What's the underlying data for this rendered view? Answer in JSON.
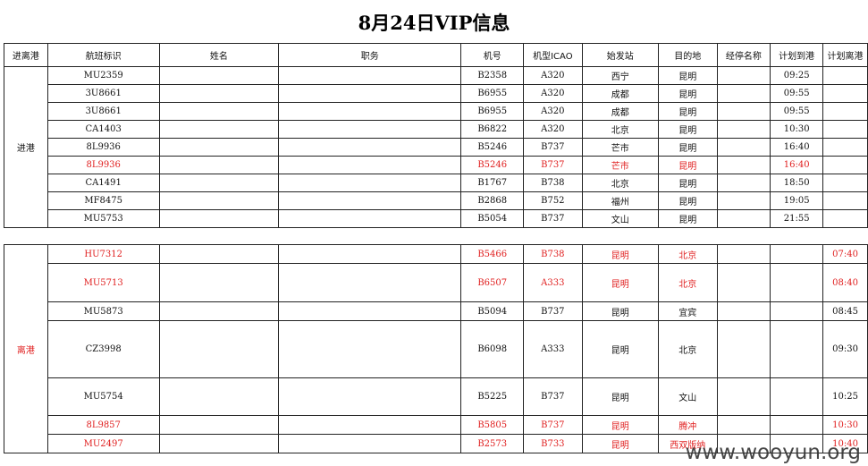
{
  "title": "8月24日VIP信息",
  "headers": [
    "进离港",
    "航班标识",
    "姓名",
    "职务",
    "机号",
    "机型ICAO",
    "始发站",
    "目的地",
    "经停名称",
    "计划到港",
    "计划离港"
  ],
  "arrival_label": "进港",
  "departure_label": "离港",
  "arrivals": [
    {
      "flight": "MU2359",
      "reg": "B2358",
      "type": "A320",
      "from": "西宁",
      "to": "昆明",
      "sta": "09:25",
      "red": false
    },
    {
      "flight": "3U8661",
      "reg": "B6955",
      "type": "A320",
      "from": "成都",
      "to": "昆明",
      "sta": "09:55",
      "red": false
    },
    {
      "flight": "3U8661",
      "reg": "B6955",
      "type": "A320",
      "from": "成都",
      "to": "昆明",
      "sta": "09:55",
      "red": false
    },
    {
      "flight": "CA1403",
      "reg": "B6822",
      "type": "A320",
      "from": "北京",
      "to": "昆明",
      "sta": "10:30",
      "red": false
    },
    {
      "flight": "8L9936",
      "reg": "B5246",
      "type": "B737",
      "from": "芒市",
      "to": "昆明",
      "sta": "16:40",
      "red": false
    },
    {
      "flight": "8L9936",
      "reg": "B5246",
      "type": "B737",
      "from": "芒市",
      "to": "昆明",
      "sta": "16:40",
      "red": true
    },
    {
      "flight": "CA1491",
      "reg": "B1767",
      "type": "B738",
      "from": "北京",
      "to": "昆明",
      "sta": "18:50",
      "red": false
    },
    {
      "flight": "MF8475",
      "reg": "B2868",
      "type": "B752",
      "from": "福州",
      "to": "昆明",
      "sta": "19:05",
      "red": false
    },
    {
      "flight": "MU5753",
      "reg": "B5054",
      "type": "B737",
      "from": "文山",
      "to": "昆明",
      "sta": "21:55",
      "red": false
    }
  ],
  "departures": [
    {
      "flight": "HU7312",
      "reg": "B5466",
      "type": "B738",
      "from": "昆明",
      "to": "北京",
      "std": "07:40",
      "red": true,
      "h": 21
    },
    {
      "flight": "MU5713",
      "reg": "B6507",
      "type": "A333",
      "from": "昆明",
      "to": "北京",
      "std": "08:40",
      "red": true,
      "h": 43
    },
    {
      "flight": "MU5873",
      "reg": "B5094",
      "type": "B737",
      "from": "昆明",
      "to": "宜宾",
      "std": "08:45",
      "red": false,
      "h": 21
    },
    {
      "flight": "CZ3998",
      "reg": "B6098",
      "type": "A333",
      "from": "昆明",
      "to": "北京",
      "std": "09:30",
      "red": false,
      "h": 64
    },
    {
      "flight": "MU5754",
      "reg": "B5225",
      "type": "B737",
      "from": "昆明",
      "to": "文山",
      "std": "10:25",
      "red": false,
      "h": 42
    },
    {
      "flight": "8L9857",
      "reg": "B5805",
      "type": "B737",
      "from": "昆明",
      "to": "腾冲",
      "std": "10:30",
      "red": true,
      "h": 21
    },
    {
      "flight": "MU2497",
      "reg": "B2573",
      "type": "B733",
      "from": "昆明",
      "to": "西双版纳",
      "std": "10:40",
      "red": true,
      "h": 21
    }
  ],
  "watermark": "www.wooyun.org"
}
